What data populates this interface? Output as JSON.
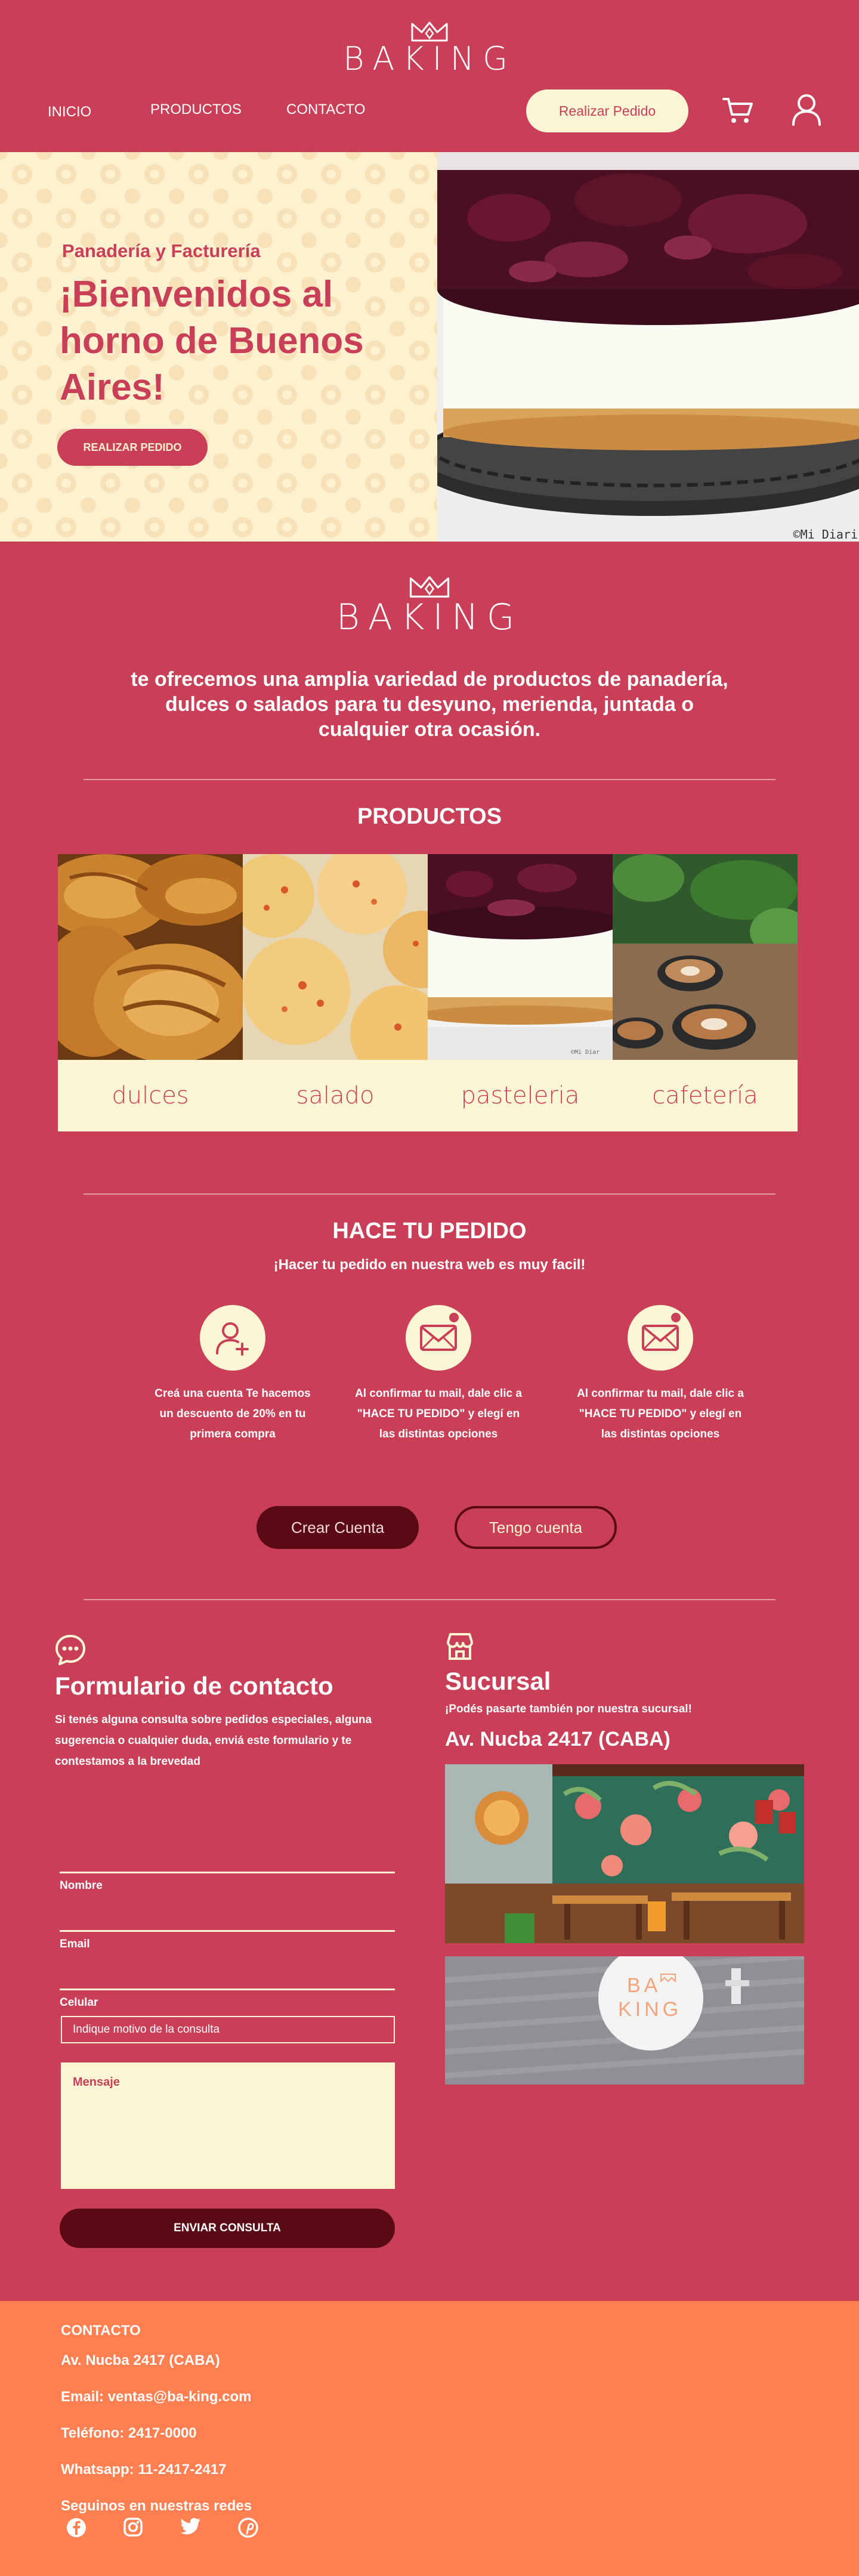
{
  "brand": {
    "name": "BAKING"
  },
  "header": {
    "nav": [
      "INICIO",
      "PRODUCTOS",
      "CONTACTO"
    ],
    "order_button": "Realizar Pedido",
    "icons": [
      "cart-icon",
      "user-icon"
    ]
  },
  "hero": {
    "subtitle": "Panadería y Facturería",
    "title": "¡Bienvenidos al horno de Buenos Aires!",
    "button": "REALIZAR PEDIDO",
    "credit": "©Mi Diari"
  },
  "intro": {
    "text": "te ofrecemos una amplia variedad de productos de panadería, dulces o salados para tu desyuno, merienda, juntada o cualquier otra ocasión."
  },
  "products": {
    "title": "PRODUCTOS",
    "items": [
      {
        "label": "dulces"
      },
      {
        "label": "salado"
      },
      {
        "label": "pasteleria"
      },
      {
        "label": "cafetería"
      }
    ]
  },
  "order": {
    "title": "HACE TU PEDIDO",
    "subtitle": "¡Hacer tu pedido en nuestra web es muy facil!",
    "steps": [
      {
        "text": "Creá una cuenta Te hacemos un descuento de 20% en tu primera compra",
        "icon": "add-user-icon"
      },
      {
        "text": "Al confirmar tu mail, dale clic a \"HACE TU PEDIDO\" y elegí en las distintas opciones",
        "icon": "mail-icon"
      },
      {
        "text": "Al confirmar tu mail, dale clic a \"HACE TU PEDIDO\" y elegí en las distintas opciones",
        "icon": "mail-icon"
      }
    ],
    "create_button": "Crear Cuenta",
    "account_button": "Tengo cuenta"
  },
  "contact": {
    "title": "Formulario de contacto",
    "description": "Si tenés alguna consulta sobre pedidos especiales, alguna sugerencia o cualquier duda, enviá este formulario y te contestamos a la brevedad",
    "fields": [
      "Nombre",
      "Email",
      "Celular"
    ],
    "select_placeholder": "Indique motivo de la consulta",
    "message_label": "Mensaje",
    "send_button": "ENVIAR CONSULTA"
  },
  "branch": {
    "title": "Sucursal",
    "description": "¡Podés pasarte también por nuestra sucursal!",
    "address": "Av. Nucba 2417 (CABA)",
    "sign_text": [
      "BA",
      "KING"
    ]
  },
  "footer": {
    "heading": "CONTACTO",
    "address": "Av. Nucba 2417 (CABA)",
    "email": "Email: ventas@ba-king.com",
    "phone": "Teléfono: 2417-0000",
    "whatsapp": "Whatsapp: 11-2417-2417",
    "social_heading": "Seguinos en nuestras redes",
    "social": [
      "facebook-icon",
      "instagram-icon",
      "twitter-icon",
      "pinterest-icon"
    ]
  },
  "colors": {
    "primary": "#c93f58",
    "cream": "#fdf6d4",
    "dark": "#5a0a14",
    "footer": "#ff7f51"
  }
}
